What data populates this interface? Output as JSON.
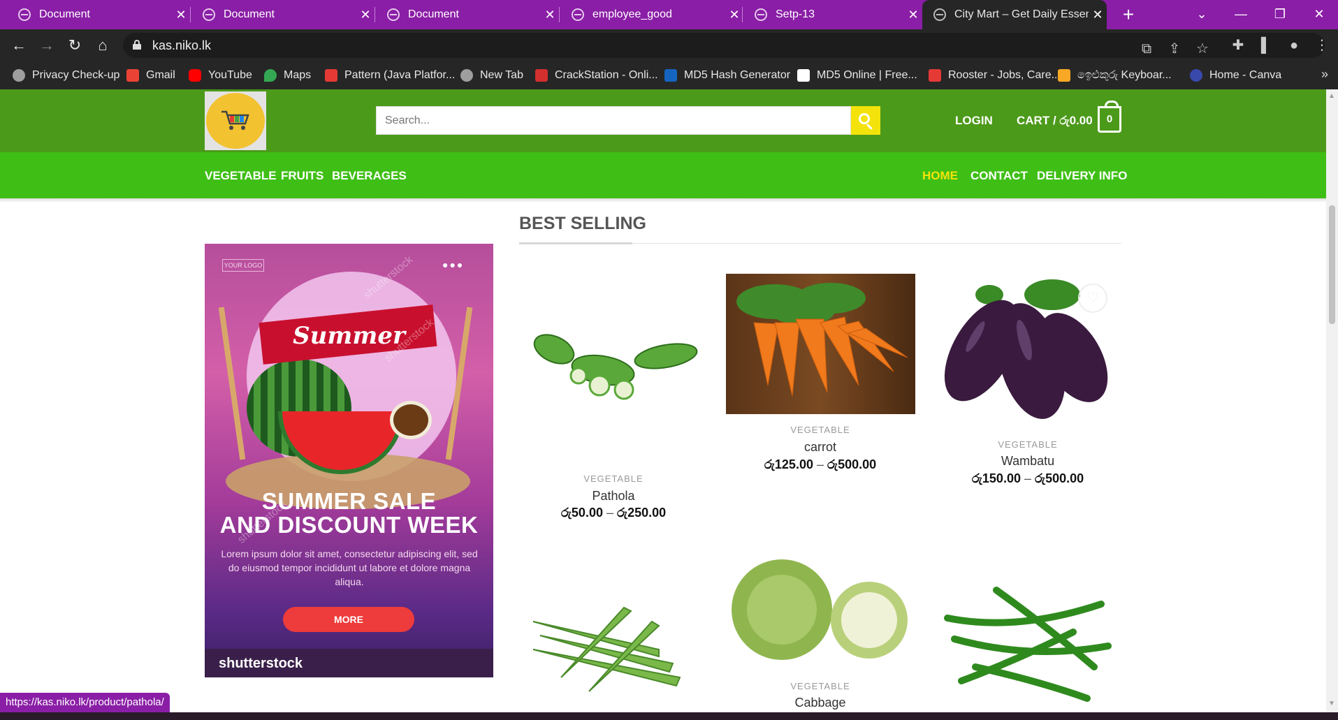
{
  "browser": {
    "tabs": [
      {
        "title": "Document"
      },
      {
        "title": "Document"
      },
      {
        "title": "Document"
      },
      {
        "title": "employee_good"
      },
      {
        "title": "Setp-13"
      },
      {
        "title": "City Mart – Get Daily Essent"
      }
    ],
    "new_tab": "+",
    "url": "kas.niko.lk",
    "bookmarks": [
      {
        "label": "Privacy Check-up",
        "color": "#9e9e9e"
      },
      {
        "label": "Gmail",
        "color": "#ea4335"
      },
      {
        "label": "YouTube",
        "color": "#ff0000"
      },
      {
        "label": "Maps",
        "color": "#34a853"
      },
      {
        "label": "Pattern (Java Platfor...",
        "color": "#e53935"
      },
      {
        "label": "New Tab",
        "color": "#9e9e9e"
      },
      {
        "label": "CrackStation - Onli...",
        "color": "#d32f2f"
      },
      {
        "label": "MD5 Hash Generator",
        "color": "#1565c0"
      },
      {
        "label": "MD5 Online | Free...",
        "color": "#ffffff"
      },
      {
        "label": "Rooster - Jobs, Care...",
        "color": "#e53935"
      },
      {
        "label": "ඉෙළුකුරු Keyboar...",
        "color": "#f9a825"
      },
      {
        "label": "Home - Canva",
        "color": "#3949ab"
      }
    ],
    "status_url": "https://kas.niko.lk/product/pathola/"
  },
  "site": {
    "search_placeholder": "Search...",
    "login": "LOGIN",
    "cart_label": "CART / රු0.00",
    "cart_count": "0",
    "nav_left": [
      "VEGETABLE",
      "FRUITS",
      "BEVERAGES"
    ],
    "nav_right": [
      "HOME",
      "CONTACT",
      "DELIVERY INFO"
    ],
    "accent_color": "#f3e30a"
  },
  "banner": {
    "logo_text": "YOUR LOGO",
    "ribbon": "Summer",
    "headline_1": "SUMMER SALE",
    "headline_2": "AND DISCOUNT WEEK",
    "body": "Lorem ipsum dolor sit amet, consectetur adipiscing elit, sed do eiusmod tempor incididunt ut labore et dolore magna aliqua.",
    "button": "MORE",
    "brand": "shutterstock",
    "watermark": "shutterstock"
  },
  "section": {
    "title": "BEST SELLING"
  },
  "products": [
    {
      "category": "VEGETABLE",
      "name": "Pathola",
      "price_min": "රු50.00",
      "price_max": "රු250.00"
    },
    {
      "category": "VEGETABLE",
      "name": "carrot",
      "price_min": "රු125.00",
      "price_max": "රු500.00"
    },
    {
      "category": "VEGETABLE",
      "name": "Wambatu",
      "price_min": "රු150.00",
      "price_max": "රු500.00"
    },
    {
      "category": "VEGETABLE",
      "name": "Cabbage"
    }
  ],
  "price_separator": "–"
}
